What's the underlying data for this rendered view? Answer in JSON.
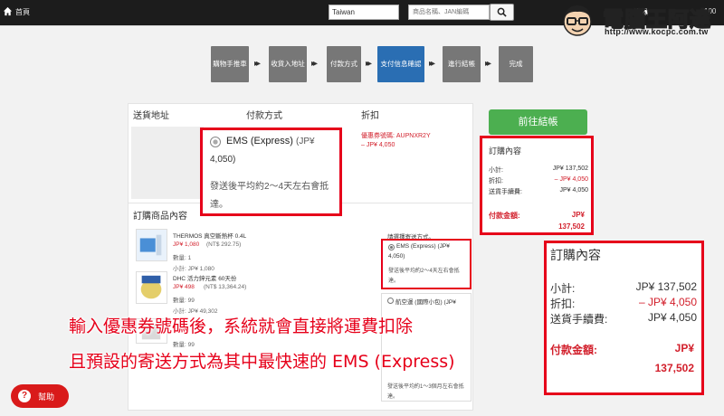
{
  "topbar": {
    "home_label": "首頁",
    "region_value": "Taiwan",
    "search_placeholder": "商品名稱、JAN編碼",
    "right_text": "登錄",
    "cart_count": "100"
  },
  "watermark": {
    "title": "電腦王阿達",
    "url": "http://www.kocpc.com.tw"
  },
  "steps": [
    "購物手推車",
    "收貨入地址",
    "付款方式",
    "支付信息確認",
    "進行結帳",
    "完成"
  ],
  "active_step_index": 3,
  "order": {
    "headers": {
      "address": "送貨地址",
      "payment": "付款方式",
      "discount": "折扣",
      "items": "訂購商品內容"
    },
    "discount_code": "優惠券號碼: AUPNXR2Y",
    "discount_amount": "– JP¥ 4,050",
    "payment_callout": {
      "method": "EMS (Express)",
      "price_part1": "(JP¥",
      "price_part2": "4,050)",
      "desc": "發送後平均約2～4天左右會抵達。"
    }
  },
  "products": [
    {
      "name": "THERMOS 真空斷熱杯 0.4L",
      "price": "JP¥ 1,080",
      "tax": "(NT$ 292.75)",
      "qty": "數量: 1",
      "subtotal": "小計: JP¥ 1,080"
    },
    {
      "name": "DHC 活力鋅元素 60天份",
      "price": "JP¥ 498",
      "tax": "(NT$ 13,364.24)",
      "qty": "數量: 99",
      "subtotal": "小計: JP¥ 49,302"
    },
    {
      "name": "",
      "price": "",
      "tax": "",
      "qty": "數量: 99",
      "subtotal": ""
    }
  ],
  "shipping": {
    "title": "請選擇寄送方式。",
    "opt1_title": "EMS (Express) (JP¥",
    "opt1_price": "4,050)",
    "opt1_desc": "發送後平均約2～4天左右會抵達。",
    "opt2_title": "航空運 (國際小包) (JP¥",
    "opt2_desc": "發送後平均約1～3個月左右會抵達。"
  },
  "checkout_button": "前往結帳",
  "summary": {
    "title": "訂購內容",
    "subtotal_label": "小計:",
    "subtotal_value": "JP¥ 137,502",
    "discount_label": "折扣:",
    "discount_value": "– JP¥ 4,050",
    "shipping_label": "送貨手續費:",
    "shipping_value": "JP¥ 4,050",
    "total_label": "付款金額:",
    "total_value_1": "JP¥",
    "total_value_2": "137,502"
  },
  "caption": {
    "line1": "輸入優惠券號碼後，系統就會直接將運費扣除",
    "line2": "且預設的寄送方式為其中最快速的 EMS (Express)"
  },
  "help_button": "幫助",
  "colors": {
    "accent_red": "#e6001a",
    "price_red": "#d21f2b",
    "active_step": "#2a6eb3",
    "checkout_green": "#4caf50"
  }
}
